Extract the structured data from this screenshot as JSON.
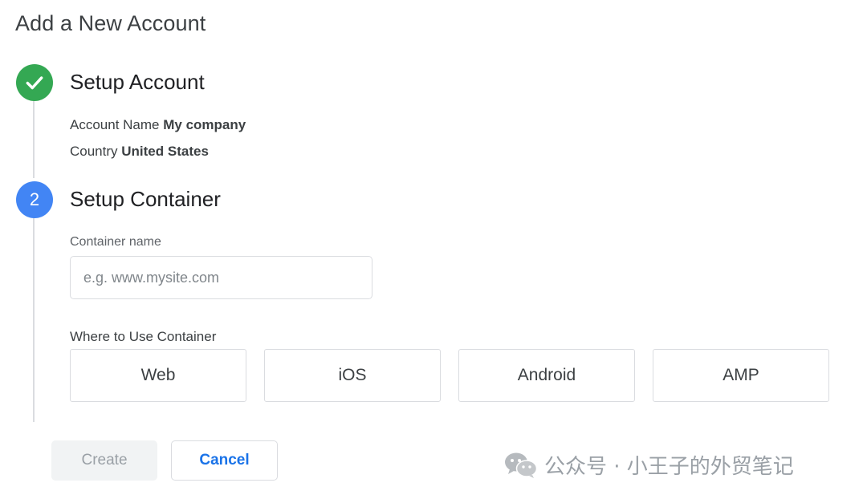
{
  "page": {
    "title": "Add a New Account"
  },
  "steps": [
    {
      "title": "Setup Account",
      "status": "complete",
      "details": [
        {
          "label": "Account Name",
          "value": "My company"
        },
        {
          "label": "Country",
          "value": "United States"
        }
      ]
    },
    {
      "number": "2",
      "title": "Setup Container",
      "status": "active"
    }
  ],
  "container_form": {
    "name_label": "Container name",
    "name_value": "",
    "name_placeholder": "e.g. www.mysite.com",
    "where_label": "Where to Use Container",
    "platforms": [
      "Web",
      "iOS",
      "Android",
      "AMP"
    ]
  },
  "actions": {
    "create_label": "Create",
    "cancel_label": "Cancel"
  },
  "watermark": {
    "text": "公众号 · 小王子的外贸笔记"
  },
  "colors": {
    "complete_green": "#34a853",
    "active_blue": "#4285f4",
    "link_blue": "#1a73e8",
    "border_gray": "#dadce0"
  },
  "icons": {
    "complete": "check-icon",
    "watermark": "wechat-icon"
  }
}
